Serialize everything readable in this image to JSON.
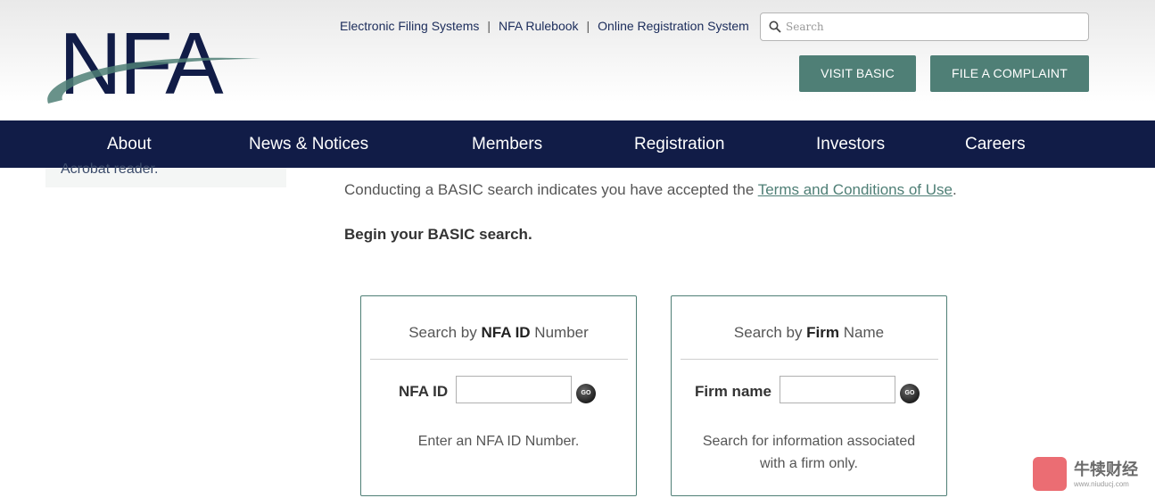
{
  "brand": {
    "logo_text": "NFA"
  },
  "top_links": [
    {
      "label": "Electronic Filing Systems"
    },
    {
      "label": "NFA Rulebook"
    },
    {
      "label": "Online Registration System"
    }
  ],
  "top_links_separator": "|",
  "search": {
    "placeholder": "Search",
    "value": "",
    "icon": "search-icon"
  },
  "header_buttons": {
    "visit_basic": "VISIT BASIC",
    "file_complaint": "FILE A COMPLAINT"
  },
  "nav": {
    "items": [
      {
        "label": "About"
      },
      {
        "label": "News & Notices"
      },
      {
        "label": "Members"
      },
      {
        "label": "Registration"
      },
      {
        "label": "Investors"
      },
      {
        "label": "Careers"
      }
    ]
  },
  "sidebar": {
    "partial_text": "Acrobat reader."
  },
  "main": {
    "intro_prefix": "Conducting a BASIC search indicates you have accepted the ",
    "intro_link": "Terms and Conditions of Use",
    "intro_suffix": ".",
    "begin_heading": "Begin your BASIC search."
  },
  "cards": {
    "nfa_id": {
      "title_prefix": "Search by ",
      "title_bold": "NFA ID",
      "title_suffix": " Number",
      "field_label": "NFA ID",
      "field_value": "",
      "go_label": "GO",
      "help": "Enter an NFA ID Number."
    },
    "firm": {
      "title_prefix": "Search by ",
      "title_bold": "Firm",
      "title_suffix": " Name",
      "field_label": "Firm name",
      "field_value": "",
      "go_label": "GO",
      "help_line1": "Search for information associated",
      "help_line2": "with a firm only."
    }
  },
  "watermark": {
    "text": "牛犊财经",
    "sub": "www.niuducj.com"
  },
  "colors": {
    "navy": "#111c47",
    "teal": "#4f7f76",
    "link": "#1a2b5a"
  }
}
